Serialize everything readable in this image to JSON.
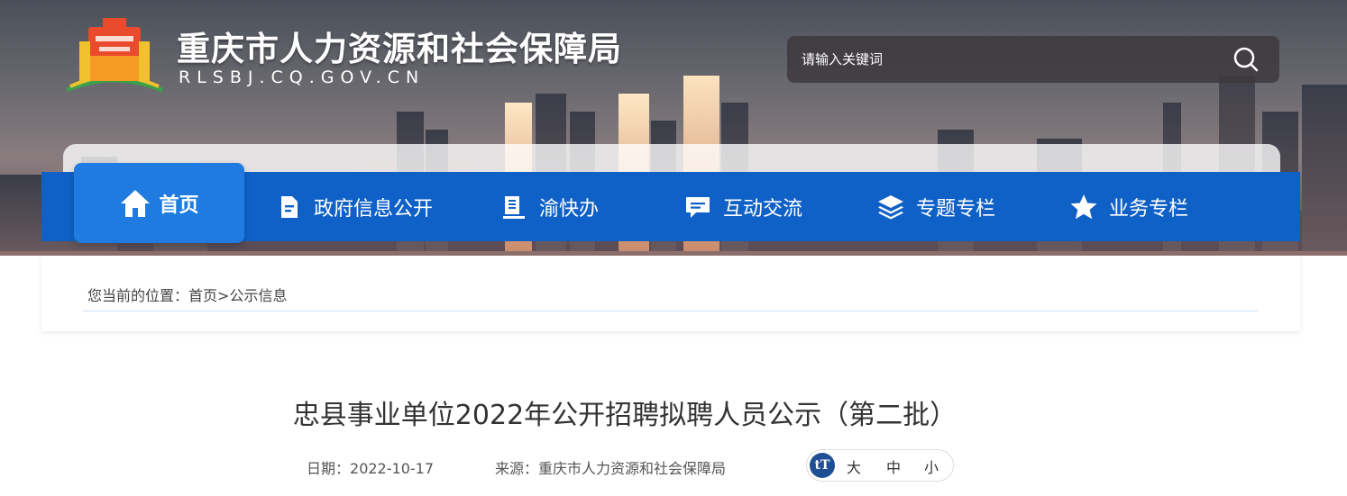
{
  "header": {
    "site_title": "重庆市人力资源和社会保障局",
    "site_domain": "RLSBJ.CQ.GOV.CN",
    "search": {
      "placeholder": "请输入关键词"
    }
  },
  "nav": {
    "items": [
      {
        "label": "首页",
        "icon": "home-icon",
        "active": true
      },
      {
        "label": "政府信息公开",
        "icon": "document-icon"
      },
      {
        "label": "渝快办",
        "icon": "book-stack-icon"
      },
      {
        "label": "互动交流",
        "icon": "chat-bubble-icon"
      },
      {
        "label": "专题专栏",
        "icon": "layers-icon"
      },
      {
        "label": "业务专栏",
        "icon": "star-icon"
      }
    ],
    "active_color": "#1f7be0",
    "bar_color": "#1061c7"
  },
  "breadcrumb": {
    "prefix": "您当前的位置：",
    "home": "首页",
    "separator": ">",
    "current": "公示信息"
  },
  "article": {
    "title": "忠县事业单位2022年公开招聘拟聘人员公示（第二批）",
    "date_label": "日期：",
    "date": "2022-10-17",
    "source_label": "来源：",
    "source": "重庆市人力资源和社会保障局",
    "font_size": {
      "icon": "tT",
      "large": "大",
      "medium": "中",
      "small": "小"
    }
  }
}
